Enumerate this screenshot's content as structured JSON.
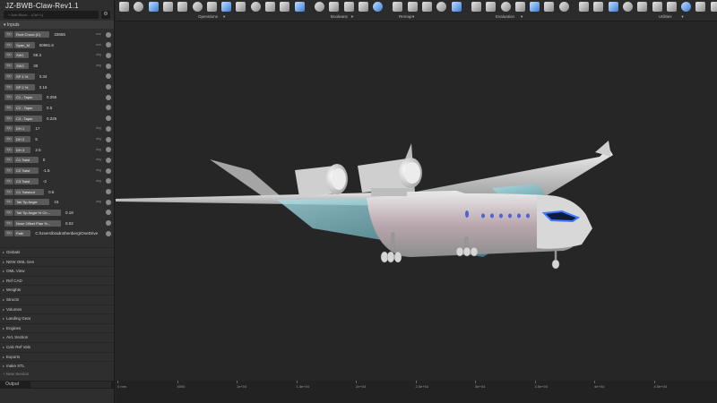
{
  "app": {
    "title": "JZ-BWB-Claw-Rev1.1",
    "add_block_placeholder": "+ Add Block... (Ctrl+L)",
    "inputs_label": "Inputs"
  },
  "params": [
    {
      "type": "f(x)",
      "name": "Root Chord (C)",
      "value": "33655",
      "unit": "mm"
    },
    {
      "type": "f(x)",
      "name": "Span_M",
      "value": "50981.6",
      "unit": "mm"
    },
    {
      "type": "f(x)",
      "name": "SW1",
      "value": "59.3",
      "unit": "deg"
    },
    {
      "type": "f(x)",
      "name": "SW2",
      "value": "30",
      "unit": "deg"
    },
    {
      "type": "f(x)",
      "name": "SP 1 %",
      "value": "0.34",
      "unit": ""
    },
    {
      "type": "f(x)",
      "name": "SP 2 %",
      "value": "0.16",
      "unit": ""
    },
    {
      "type": "f(x)",
      "name": "C1 - Taper",
      "value": "0.255",
      "unit": ""
    },
    {
      "type": "f(x)",
      "name": "C2 - Taper",
      "value": "0.5",
      "unit": ""
    },
    {
      "type": "f(x)",
      "name": "C3 - Taper",
      "value": "0.225",
      "unit": ""
    },
    {
      "type": "f(x)",
      "name": "DH 1",
      "value": "17",
      "unit": "deg"
    },
    {
      "type": "f(x)",
      "name": "DH 2",
      "value": "5",
      "unit": "deg"
    },
    {
      "type": "f(x)",
      "name": "DH 3",
      "value": "2.5",
      "unit": "deg"
    },
    {
      "type": "f(x)",
      "name": "C1 Twist",
      "value": "0",
      "unit": "deg"
    },
    {
      "type": "f(x)",
      "name": "C2 Twist",
      "value": "-1.5",
      "unit": "deg"
    },
    {
      "type": "f(x)",
      "name": "C3 Twist",
      "value": "-3",
      "unit": "deg"
    },
    {
      "type": "f(x)",
      "name": "C1 Twistout",
      "value": "0.5",
      "unit": ""
    },
    {
      "type": "f(x)",
      "name": "Tail Tip Angle",
      "value": "15",
      "unit": "deg"
    },
    {
      "type": "f(x)",
      "name": "Tail Tip Angle % Ch...",
      "value": "0.18",
      "unit": ""
    },
    {
      "type": "f(x)",
      "name": "Nose Offset Plan %...",
      "value": "0.02",
      "unit": ""
    },
    {
      "type": "f(x)",
      "name": "Path",
      "value": "C:\\Users\\bradrothenberg\\OneDrive",
      "unit": ""
    }
  ],
  "sections": [
    "Globals",
    "NEW OML Gen",
    "OML View",
    "Ref CAD",
    "Weights",
    "Structs",
    "Volumes",
    "Landing Gear",
    "Engines",
    "AVL Section",
    "Calc Ref Vals",
    "Exports",
    "make STL"
  ],
  "new_section_label": "+ New Section",
  "output_label": "Output",
  "toolbar": {
    "groups": [
      "Operations",
      "Booleans",
      "Remap",
      "Evaluation",
      "Utilities"
    ]
  },
  "ruler": {
    "labels": [
      "0 mm",
      "5000",
      "1e+04",
      "1.5e+04",
      "2e+04",
      "2.5e+04",
      "3e+04",
      "3.5e+04",
      "4e+04",
      "4.5e+04"
    ]
  },
  "colors": {
    "sidebar_bg": "#2e2e2e",
    "viewport_bg": "#262626",
    "cockpit_accent": "#3f7bff"
  },
  "icons": {
    "settings": "gear-icon",
    "section_expander": "chevron-right-icon",
    "param_menu": "gear-icon"
  }
}
